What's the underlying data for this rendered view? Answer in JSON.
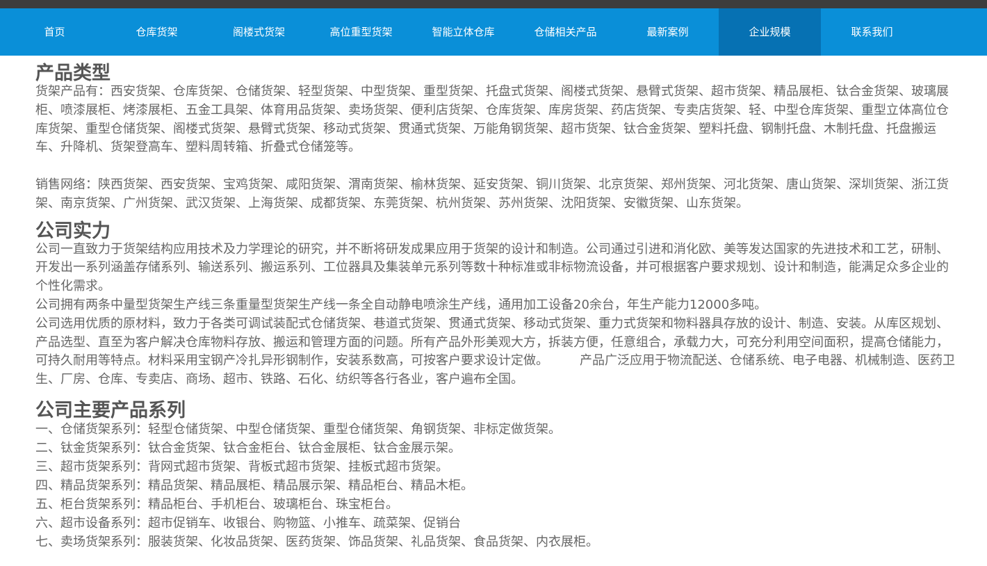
{
  "nav": {
    "items": [
      {
        "label": "首页"
      },
      {
        "label": "仓库货架"
      },
      {
        "label": "阁楼式货架"
      },
      {
        "label": "高位重型货架"
      },
      {
        "label": "智能立体仓库"
      },
      {
        "label": "仓储相关产品"
      },
      {
        "label": "最新案例"
      },
      {
        "label": "企业规模"
      },
      {
        "label": "联系我们"
      }
    ],
    "active_index": 7,
    "bar_color": "#0a8fd8",
    "active_color": "#0671b3"
  },
  "sections": {
    "products": {
      "title": "产品类型",
      "p1": "货架产品有：西安货架、仓库货架、仓储货架、轻型货架、中型货架、重型货架、托盘式货架、阁楼式货架、悬臂式货架、超市货架、精品展柜、钛合金货架、玻璃展柜、喷漆展柜、烤漆展柜、五金工具架、体育用品货架、卖场货架、便利店货架、仓库货架、库房货架、药店货架、专卖店货架、轻、中型仓库货架、重型立体高位仓库货架、重型仓储货架、阁楼式货架、悬臂式货架、移动式货架、贯通式货架、万能角钢货架、超市货架、钛合金货架、塑料托盘、钢制托盘、木制托盘、托盘搬运车、升降机、货架登高车、塑料周转箱、折叠式仓储笼等。",
      "p2": "销售网络：陕西货架、西安货架、宝鸡货架、咸阳货架、渭南货架、榆林货架、延安货架、铜川货架、北京货架、郑州货架、河北货架、唐山货架、深圳货架、浙江货架、南京货架、广州货架、武汉货架、上海货架、成都货架、东莞货架、杭州货架、苏州货架、沈阳货架、安徽货架、山东货架。"
    },
    "strength": {
      "title": "公司实力",
      "p1": "公司一直致力于货架结构应用技术及力学理论的研究，并不断将研发成果应用于货架的设计和制造。公司通过引进和消化欧、美等发达国家的先进技术和工艺，研制、开发出一系列涵盖存储系列、输送系列、搬运系列、工位器具及集装单元系列等数十种标准或非标物流设备，并可根据客户要求规划、设计和制造，能满足众多企业的个性化需求。",
      "p2": "公司拥有两条中量型货架生产线三条重量型货架生产线一条全自动静电喷涂生产线，通用加工设备20余台，年生产能力12000多吨。",
      "p3": "公司选用优质的原材料，致力于各类可调试装配式仓储货架、巷道式货架、贯通式货架、移动式货架、重力式货架和物料器具存放的设计、制造、安装。从库区规划、产品选型、直至为客户解决仓库物料存放、搬运和管理方面的问题。所有产品外形美观大方，拆装方便，任意组合，承载力大，可充分利用空间面积，提高仓储能力，可持久耐用等特点。材料采用宝钢产冷扎异形钢制作，安装系数高，可按客户要求设计定做。　　　产品广泛应用于物流配送、仓储系统、电子电器、机械制造、医药卫生、厂房、仓库、专卖店、商场、超市、铁路、石化、纺织等各行各业，客户遍布全国。"
    },
    "series": {
      "title": "公司主要产品系列",
      "items": [
        "一、仓储货架系列：轻型仓储货架、中型仓储货架、重型仓储货架、角钢货架、非标定做货架。",
        "二、钛金货架系列：钛合金货架、钛合金柜台、钛合金展柜、钛合金展示架。",
        "三、超市货架系列：背网式超市货架、背板式超市货架、挂板式超市货架。",
        "四、精品货架系列：精品货架、精品展柜、精品展示架、精品柜台、精品木柜。",
        "五、柜台货架系列：精品柜台、手机柜台、玻璃柜台、珠宝柜台。",
        "六、超市设备系列：超市促销车、收银台、购物篮、小推车、疏菜架、促销台",
        "七、卖场货架系列：服装货架、化妆品货架、医药货架、饰品货架、礼品货架、食品货架、内衣展柜。"
      ]
    }
  }
}
